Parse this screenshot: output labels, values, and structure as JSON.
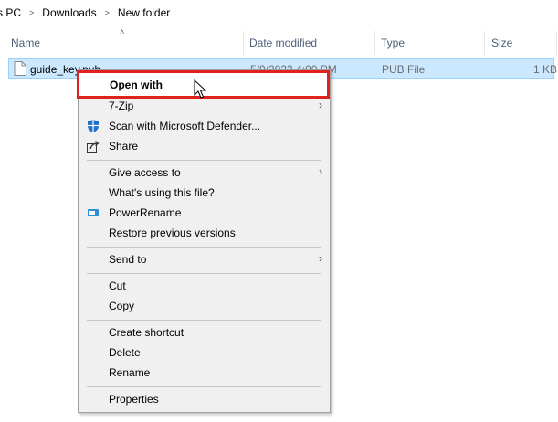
{
  "breadcrumb": {
    "items": [
      "s PC",
      "Downloads",
      "New folder"
    ]
  },
  "columns": {
    "name": "Name",
    "date_modified": "Date modified",
    "type": "Type",
    "size": "Size"
  },
  "file": {
    "name": "guide_key.pub",
    "date": "5/9/2023 4:00 PM",
    "type": "PUB File",
    "size": "1 KB"
  },
  "menu": {
    "open_with": "Open with",
    "seven_zip": "7-Zip",
    "scan": "Scan with Microsoft Defender...",
    "share": "Share",
    "give_access": "Give access to",
    "whats_using": "What's using this file?",
    "power_rename": "PowerRename",
    "restore": "Restore previous versions",
    "send_to": "Send to",
    "cut": "Cut",
    "copy": "Copy",
    "create_shortcut": "Create shortcut",
    "delete": "Delete",
    "rename": "Rename",
    "properties": "Properties"
  },
  "colors": {
    "highlight_border": "#e0211d",
    "selection_bg": "#cce8ff",
    "menu_bg": "#f0f0f0"
  },
  "icons": {
    "submenu": "chevron-right-icon",
    "defender": "shield-icon",
    "share": "share-icon",
    "power_rename": "power-rename-icon"
  }
}
